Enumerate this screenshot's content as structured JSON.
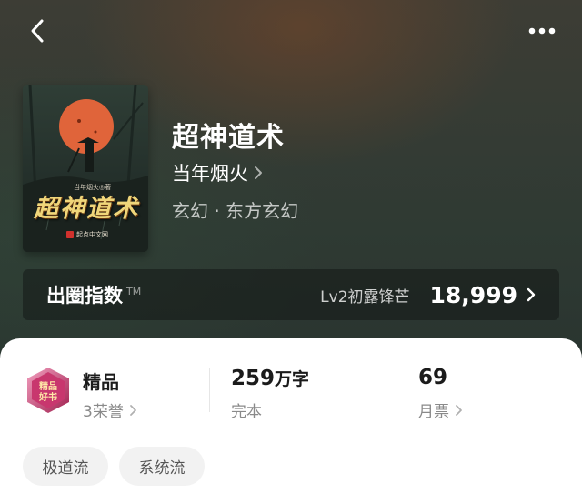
{
  "cover": {
    "author_line": "当年烟火◎著",
    "title": "超神道术",
    "publisher": "起点中文网"
  },
  "book": {
    "title": "超神道术",
    "author": "当年烟火",
    "genre": "玄幻 · 东方玄幻"
  },
  "influence": {
    "title": "出圈指数",
    "trademark": "TM",
    "level": "Lv2初露锋芒",
    "score": "18,999"
  },
  "stats": {
    "quality": {
      "label": "精品",
      "sub": "3荣誉"
    },
    "words": {
      "number": "259",
      "unit": "万字",
      "sub": "完本"
    },
    "votes": {
      "number": "69",
      "sub": "月票"
    }
  },
  "badge_text": "精品好书",
  "tags": [
    "极道流",
    "系统流"
  ],
  "colors": {
    "accent_badge": "#c8376e",
    "cover_sun": "#e0643a",
    "title_gold": "#f0d67a"
  },
  "icons": [
    "back-arrow-icon",
    "more-dots-icon",
    "chevron-right-icon"
  ]
}
